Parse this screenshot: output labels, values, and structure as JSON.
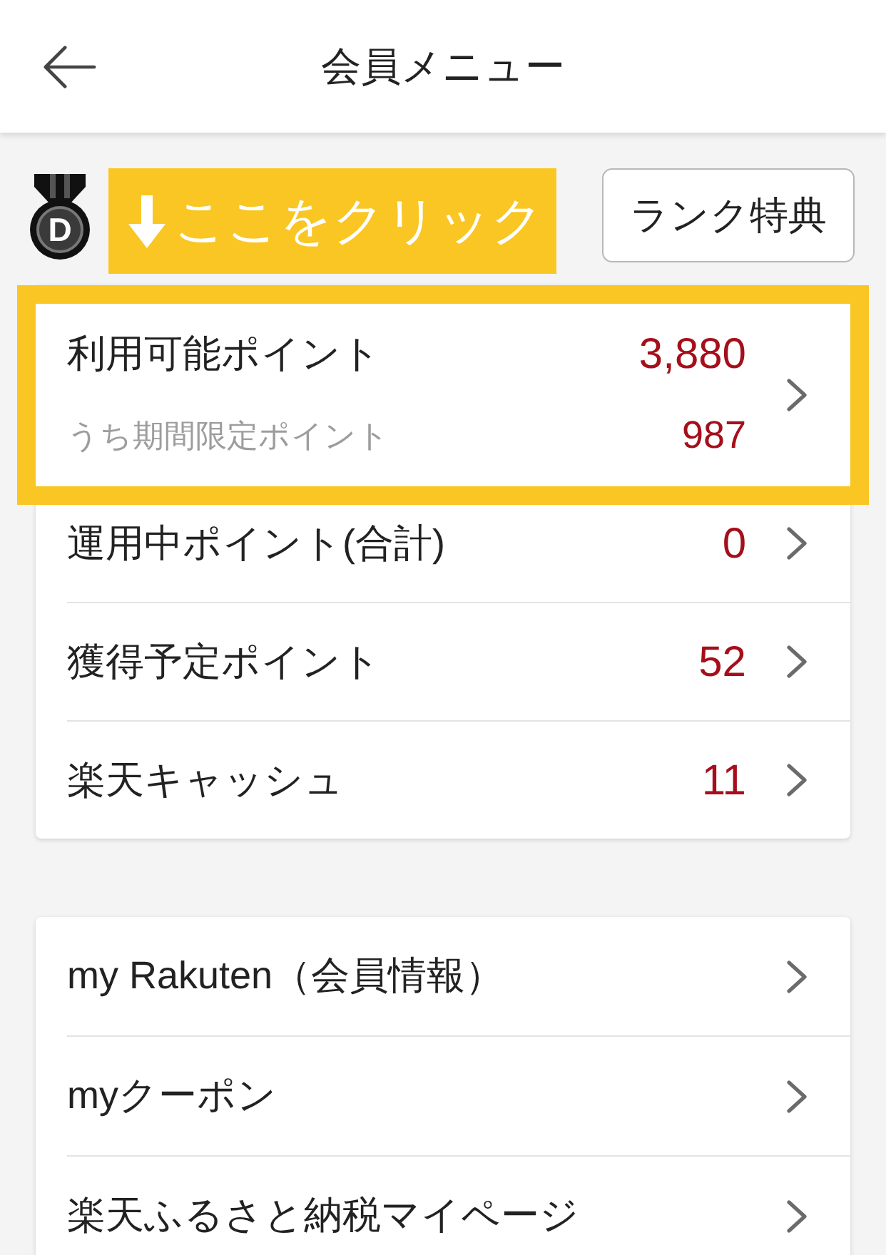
{
  "header": {
    "title": "会員メニュー"
  },
  "rank": {
    "badge_letter": "D",
    "callout": "ここをクリック",
    "benefits_button": "ランク特典"
  },
  "points_card": {
    "items": [
      {
        "label": "利用可能ポイント",
        "value": "3,880",
        "sub_label": "うち期間限定ポイント",
        "sub_value": "987",
        "highlighted": true
      },
      {
        "label": "運用中ポイント(合計)",
        "value": "0",
        "highlighted": false
      },
      {
        "label": "獲得予定ポイント",
        "value": "52",
        "highlighted": false
      },
      {
        "label": "楽天キャッシュ",
        "value": "11",
        "highlighted": false
      }
    ]
  },
  "menu_card": {
    "items": [
      {
        "label": "my Rakuten（会員情報）"
      },
      {
        "label": "myクーポン"
      },
      {
        "label": "楽天ふるさと納税マイページ"
      }
    ]
  }
}
